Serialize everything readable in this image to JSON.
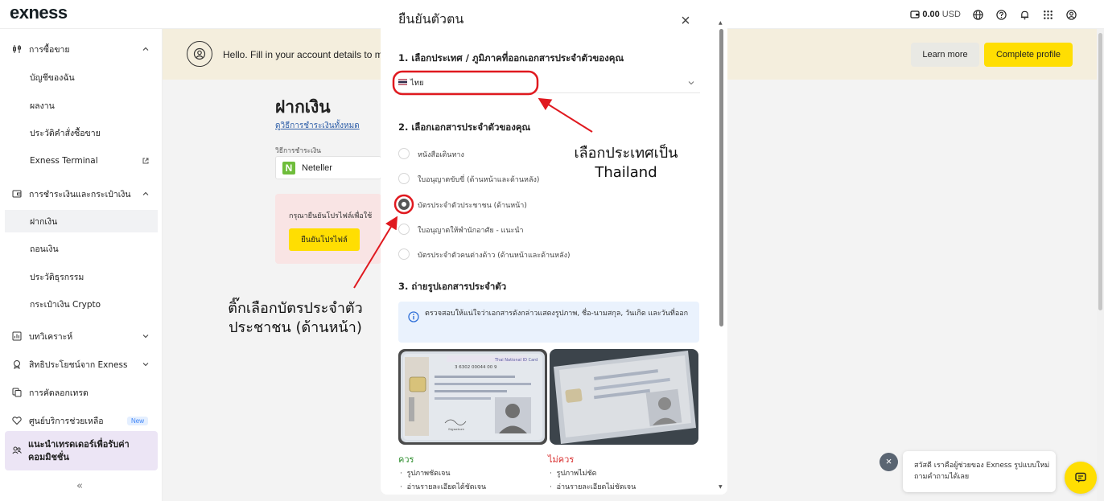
{
  "app": {
    "logo": "exness"
  },
  "topbar": {
    "balance": "0.00",
    "currency": "USD"
  },
  "sidebar": {
    "trading": {
      "label": "การซื้อขาย"
    },
    "trading_items": [
      "บัญชีของฉัน",
      "ผลงาน",
      "ประวัติคำสั่งซื้อขาย",
      "Exness Terminal"
    ],
    "payments": {
      "label": "การชำระเงินและกระเป๋าเงิน"
    },
    "payment_items": [
      "ฝากเงิน",
      "ถอนเงิน",
      "ประวัติธุรกรรม",
      "กระเป๋าเงิน Crypto"
    ],
    "analytics": {
      "label": "บทวิเคราะห์"
    },
    "benefits": {
      "label": "สิทธิประโยชน์จาก Exness"
    },
    "copytrading": {
      "label": "การคัดลอกเทรด"
    },
    "support": {
      "label": "ศูนย์บริการช่วยเหลือ",
      "badge": "New"
    },
    "promo": {
      "label": "แนะนำเทรดเดอร์เพื่อรับค่าคอมมิชชั่น"
    },
    "collapse": "«"
  },
  "banner": {
    "text": "Hello. Fill in your account details to ma",
    "learn_more": "Learn more",
    "complete_profile": "Complete profile"
  },
  "deposit": {
    "title": "ฝากเงิน",
    "link": "ดูวิธีการชำระเงินทั้งหมด",
    "method_label": "วิธีการชำระเงิน",
    "method": "Neteller",
    "method_logo": "N",
    "verify_text": "กรุณายืนยันโปรไฟล์เพื่อใช้",
    "verify_button": "ยืนยันโปรไฟล์"
  },
  "modal": {
    "title": "ยืนยันตัวตน",
    "close": "×",
    "step1": "1. เลือกประเทศ / ภูมิภาคที่ออกเอกสารประจำตัวของคุณ",
    "country": "ไทย",
    "step2": "2. เลือกเอกสารประจำตัวของคุณ",
    "doc_options": [
      "หนังสือเดินทาง",
      "ใบอนุญาตขับขี่ (ด้านหน้าและด้านหลัง)",
      "บัตรประจำตัวประชาชน (ด้านหน้า)",
      "ใบอนุญาตให้พำนักอาศัย - แนะนำ",
      "บัตรประจำตัวคนต่างด้าว (ด้านหน้าและด้านหลัง)"
    ],
    "selected_option": 2,
    "step3": "3. ถ่ายรูปเอกสารประจำตัว",
    "info": "ตรวจสอบให้แน่ใจว่าเอกสารดังกล่าวแสดงรูปภาพ, ชื่อ-นามสกุล, วันเกิด และวันที่ออก",
    "id_card_heading": "Thai National ID Card",
    "id_card_number": "3 6302 00044 00 9",
    "signature": "Signature",
    "good_heading": "ควร",
    "good_points": [
      "รูปภาพชัดเจน",
      "อ่านรายละเอียดได้ชัดเจน"
    ],
    "bad_heading": "ไม่ควร",
    "bad_points": [
      "รูปภาพไม่ชัด",
      "อ่านรายละเอียดไม่ชัดเจน"
    ]
  },
  "annotations": {
    "country_note": [
      "เลือกประเทศเป็น",
      "Thailand"
    ],
    "idcard_note": [
      "ติ๊กเลือกบัตรประจำตัว",
      "ประชาชน (ด้านหน้า)"
    ],
    "color": "#e0191f"
  },
  "chat": {
    "close": "×",
    "message": "สวัสดี เราคือผู้ช่วยของ Exness รูปแบบใหม่ ถามคำถามได้เลย"
  },
  "colors": {
    "accent_yellow": "#ffde02",
    "banner": "#f4eedd",
    "annotation_red": "#e0191f"
  }
}
